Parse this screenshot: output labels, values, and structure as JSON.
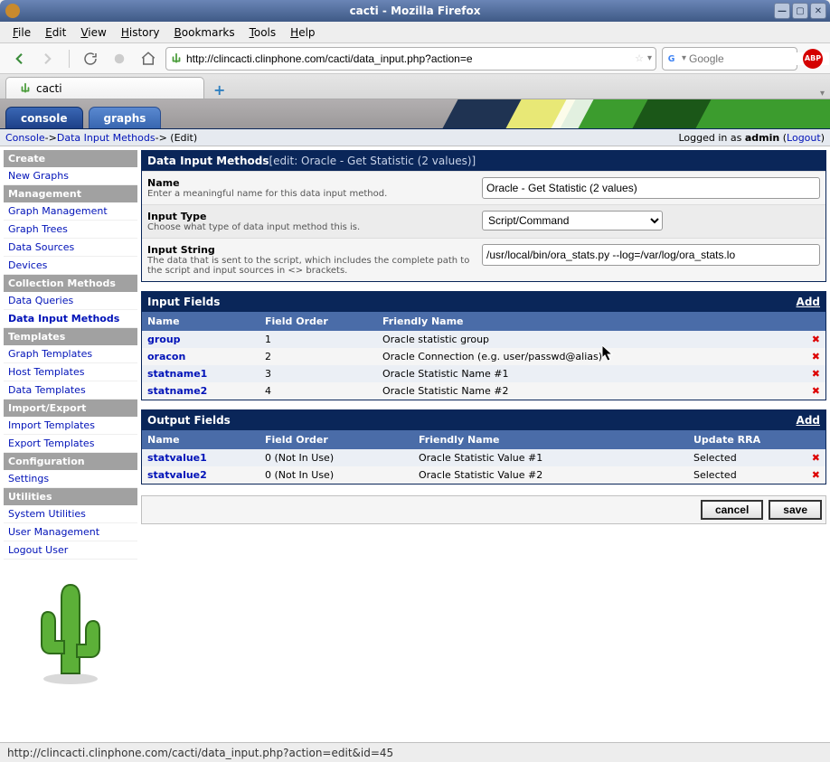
{
  "window": {
    "title": "cacti - Mozilla Firefox"
  },
  "menubar": [
    "File",
    "Edit",
    "View",
    "History",
    "Bookmarks",
    "Tools",
    "Help"
  ],
  "url": "http://clincacti.clinphone.com/cacti/data_input.php?action=e",
  "search_placeholder": "Google",
  "browser_tab": "cacti",
  "app_tabs": {
    "console": "console",
    "graphs": "graphs"
  },
  "breadcrumb": {
    "a": "Console",
    "sep1": " -> ",
    "b": "Data Input Methods",
    "sep2": " -> (Edit)"
  },
  "login": {
    "prefix": "Logged in as ",
    "user": "admin",
    "logout": "Logout"
  },
  "sidebar": {
    "sections": [
      {
        "header": "Create",
        "items": [
          {
            "label": "New Graphs"
          }
        ]
      },
      {
        "header": "Management",
        "items": [
          {
            "label": "Graph Management"
          },
          {
            "label": "Graph Trees"
          },
          {
            "label": "Data Sources"
          },
          {
            "label": "Devices"
          }
        ]
      },
      {
        "header": "Collection Methods",
        "items": [
          {
            "label": "Data Queries"
          },
          {
            "label": "Data Input Methods",
            "active": true
          }
        ]
      },
      {
        "header": "Templates",
        "items": [
          {
            "label": "Graph Templates"
          },
          {
            "label": "Host Templates"
          },
          {
            "label": "Data Templates"
          }
        ]
      },
      {
        "header": "Import/Export",
        "items": [
          {
            "label": "Import Templates"
          },
          {
            "label": "Export Templates"
          }
        ]
      },
      {
        "header": "Configuration",
        "items": [
          {
            "label": "Settings"
          }
        ]
      },
      {
        "header": "Utilities",
        "items": [
          {
            "label": "System Utilities"
          },
          {
            "label": "User Management"
          },
          {
            "label": "Logout User"
          }
        ]
      }
    ]
  },
  "form_panel": {
    "title": "Data Input Methods",
    "subtitle": " [edit: Oracle - Get Statistic (2 values)]",
    "rows": [
      {
        "name": "Name",
        "help": "Enter a meaningful name for this data input method.",
        "type": "text",
        "value": "Oracle - Get Statistic (2 values)"
      },
      {
        "name": "Input Type",
        "help": "Choose what type of data input method this is.",
        "type": "select",
        "value": "Script/Command"
      },
      {
        "name": "Input String",
        "help": "The data that is sent to the script, which includes the complete path to the script and input sources in <> brackets.",
        "type": "text",
        "value": "/usr/local/bin/ora_stats.py --log=/var/log/ora_stats.lo"
      }
    ]
  },
  "input_fields": {
    "title": "Input Fields",
    "add": "Add",
    "headers": {
      "name": "Name",
      "order": "Field Order",
      "friendly": "Friendly Name"
    },
    "rows": [
      {
        "name": "group",
        "order": "1",
        "friendly": "Oracle statistic group"
      },
      {
        "name": "oracon",
        "order": "2",
        "friendly": "Oracle Connection (e.g. user/passwd@alias)"
      },
      {
        "name": "statname1",
        "order": "3",
        "friendly": "Oracle Statistic Name #1"
      },
      {
        "name": "statname2",
        "order": "4",
        "friendly": "Oracle Statistic Name #2"
      }
    ]
  },
  "output_fields": {
    "title": "Output Fields",
    "add": "Add",
    "headers": {
      "name": "Name",
      "order": "Field Order",
      "friendly": "Friendly Name",
      "update": "Update RRA"
    },
    "rows": [
      {
        "name": "statvalue1",
        "order": "0 (Not In Use)",
        "friendly": "Oracle Statistic Value #1",
        "update": "Selected"
      },
      {
        "name": "statvalue2",
        "order": "0 (Not In Use)",
        "friendly": "Oracle Statistic Value #2",
        "update": "Selected"
      }
    ]
  },
  "actions": {
    "cancel": "cancel",
    "save": "save"
  },
  "status_url": "http://clincacti.clinphone.com/cacti/data_input.php?action=edit&id=45"
}
